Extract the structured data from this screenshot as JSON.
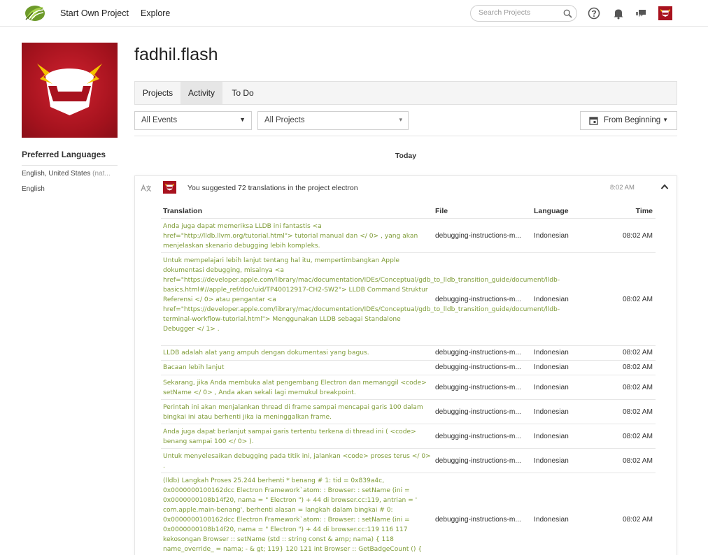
{
  "nav": {
    "start_own_project": "Start Own Project",
    "explore": "Explore",
    "search_placeholder": "Search Projects"
  },
  "icons": {
    "logo": "leaf-logo-icon",
    "search": "search-icon",
    "help": "help-icon",
    "notifications": "bell-icon",
    "messages": "chat-icon",
    "calendar": "calendar-icon",
    "translate": "translate-icon",
    "collapse": "chevron-up-icon"
  },
  "colors": {
    "brand_green": "#8cc63f",
    "avatar_red": "#a8121e",
    "translation_text": "#7d9a35"
  },
  "profile": {
    "username": "fadhil.flash",
    "preferred_languages_title": "Preferred Languages",
    "languages": [
      {
        "name": "English, United States",
        "note": "(nat..."
      },
      {
        "name": "English",
        "note": ""
      }
    ]
  },
  "tabs": [
    {
      "label": "Projects",
      "active": false
    },
    {
      "label": "Activity",
      "active": true
    },
    {
      "label": "To Do",
      "active": false
    }
  ],
  "filters": {
    "events": "All Events",
    "projects": "All Projects",
    "date": "From Beginning"
  },
  "feed": {
    "day": "Today",
    "event_text": "You suggested 72 translations in the project electron",
    "event_time": "8:02 AM",
    "columns": [
      "Translation",
      "File",
      "Language",
      "Time"
    ],
    "rows": [
      {
        "translation": "Anda juga dapat memeriksa LLDB ini fantastis <a href=\"http://lldb.llvm.org/tutorial.html\"> tutorial manual dan </ 0> , yang akan menjelaskan skenario debugging lebih kompleks.",
        "file": "debugging-instructions-m...",
        "language": "Indonesian",
        "time": "08:02 AM"
      },
      {
        "translation": "Untuk mempelajari lebih lanjut tentang hal itu, mempertimbangkan Apple dokumentasi debugging, misalnya <a href=\"https://developer.apple.com/library/mac/documentation/IDEs/Conceptual/gdb_to_lldb_transition_guide/document/lldb-basics.html#//apple_ref/doc/uid/TP40012917-CH2-SW2\"> LLDB Command Struktur Referensi </ 0> atau pengantar <a href=\"https://developer.apple.com/library/mac/documentation/IDEs/Conceptual/gdb_to_lldb_transition_guide/document/lldb-terminal-workflow-tutorial.html\"> Menggunakan LLDB sebagai Standalone Debugger </ 1> .",
        "file": "debugging-instructions-m...",
        "language": "Indonesian",
        "time": "08:02 AM"
      },
      {
        "translation": "LLDB adalah alat yang ampuh dengan dokumentasi yang bagus.",
        "file": "debugging-instructions-m...",
        "language": "Indonesian",
        "time": "08:02 AM"
      },
      {
        "translation": "Bacaan lebih lanjut",
        "file": "debugging-instructions-m...",
        "language": "Indonesian",
        "time": "08:02 AM"
      },
      {
        "translation": "Sekarang, jika Anda membuka alat pengembang Electron dan memanggil <code> setName </ 0> , Anda akan sekali lagi memukul breakpoint.",
        "file": "debugging-instructions-m...",
        "language": "Indonesian",
        "time": "08:02 AM"
      },
      {
        "translation": "Perintah ini akan menjalankan thread di frame sampai mencapai garis 100 dalam bingkai ini atau berhenti jika ia meninggalkan frame.",
        "file": "debugging-instructions-m...",
        "language": "Indonesian",
        "time": "08:02 AM"
      },
      {
        "translation": "Anda juga dapat berlanjut sampai garis tertentu terkena di thread ini ( <code> benang sampai 100 </ 0> ).",
        "file": "debugging-instructions-m...",
        "language": "Indonesian",
        "time": "08:02 AM"
      },
      {
        "translation": "Untuk menyelesaikan debugging pada titik ini, jalankan <code> proses terus </ 0> .",
        "file": "debugging-instructions-m...",
        "language": "Indonesian",
        "time": "08:02 AM"
      },
      {
        "translation": "(lldb) Langkah Proses 25.244 berhenti * benang # 1: tid = 0x839a4c, 0x0000000100162dcc Electron Framework`atom: : Browser: : setName (ini = 0x0000000108b14f20, nama = \" Electron \") + 44 di browser.cc:119, antrian = ' com.apple.main-benang', berhenti alasan = langkah dalam bingkai # 0: 0x0000000100162dcc Electron Framework`atom: : Browser: : setName (ini = 0x0000000108b14f20, nama = \" Electron \") + 44 di browser.cc:119 116 117 kekosongan Browser :: setName (std :: string const & amp; nama) { 118 name_override_ = nama; - & gt; 119} 120 121 int Browser :: GetBadgeCount () {",
        "file": "debugging-instructions-m...",
        "language": "Indonesian",
        "time": "08:02 AM"
      }
    ]
  }
}
